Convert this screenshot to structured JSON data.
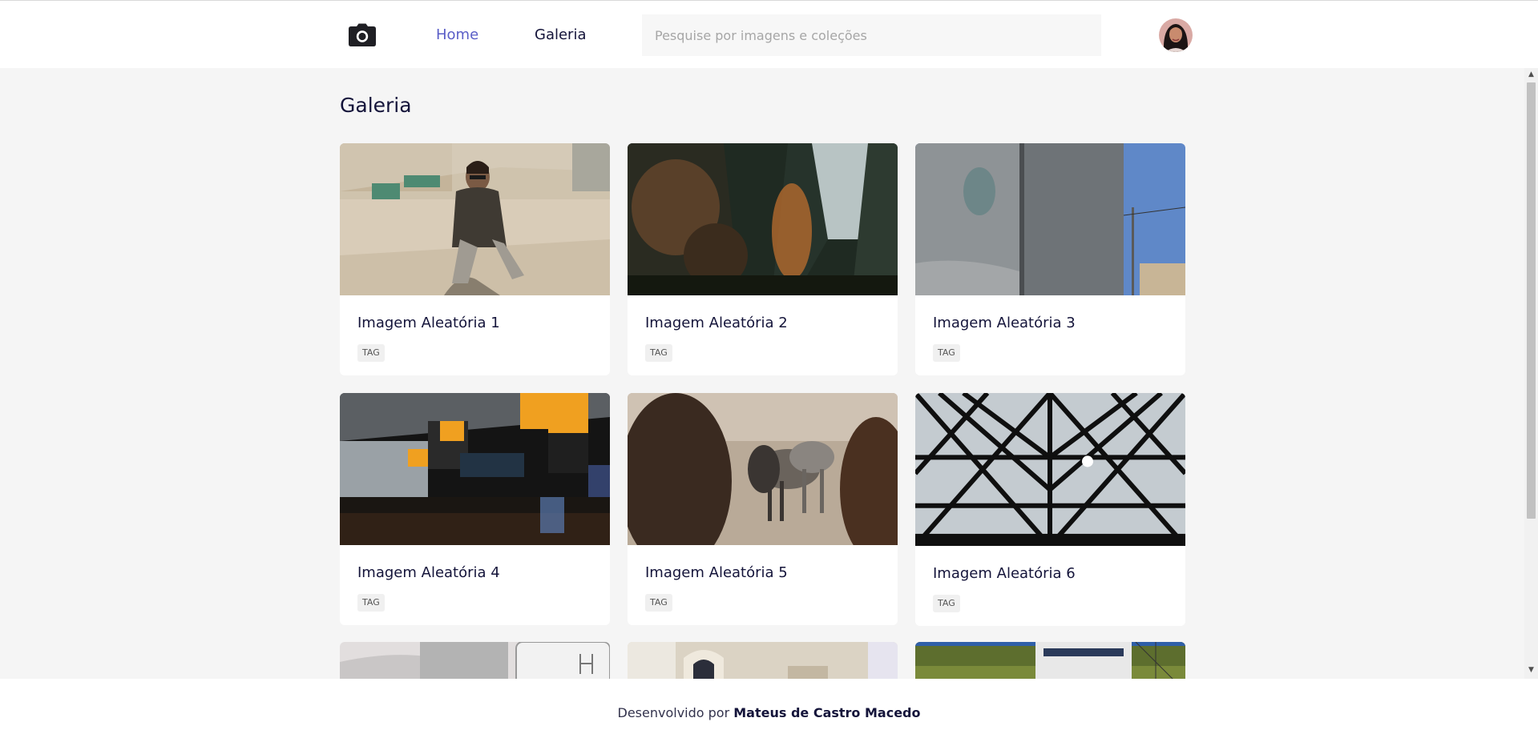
{
  "header": {
    "logo_icon": "camera-icon",
    "nav": [
      {
        "label": "Home",
        "active": true,
        "color": "#5a5ec7"
      },
      {
        "label": "Galeria",
        "active": false,
        "color": "#14143a"
      }
    ],
    "search": {
      "placeholder": "Pesquise por imagens e coleções",
      "value": ""
    },
    "avatar_icon": "user-avatar"
  },
  "page": {
    "title": "Galeria"
  },
  "gallery": {
    "cards": [
      {
        "title": "Imagem Aleatória 1",
        "tag": "TAG"
      },
      {
        "title": "Imagem Aleatória 2",
        "tag": "TAG"
      },
      {
        "title": "Imagem Aleatória 3",
        "tag": "TAG"
      },
      {
        "title": "Imagem Aleatória 4",
        "tag": "TAG"
      },
      {
        "title": "Imagem Aleatória 5",
        "tag": "TAG"
      },
      {
        "title": "Imagem Aleatória 6",
        "tag": "TAG"
      }
    ]
  },
  "footer": {
    "prefix": "Desenvolvido por",
    "author": "Mateus de Castro Macedo"
  },
  "colors": {
    "accent": "#5a5ec7",
    "text": "#14143a",
    "background": "#f5f5f5"
  }
}
